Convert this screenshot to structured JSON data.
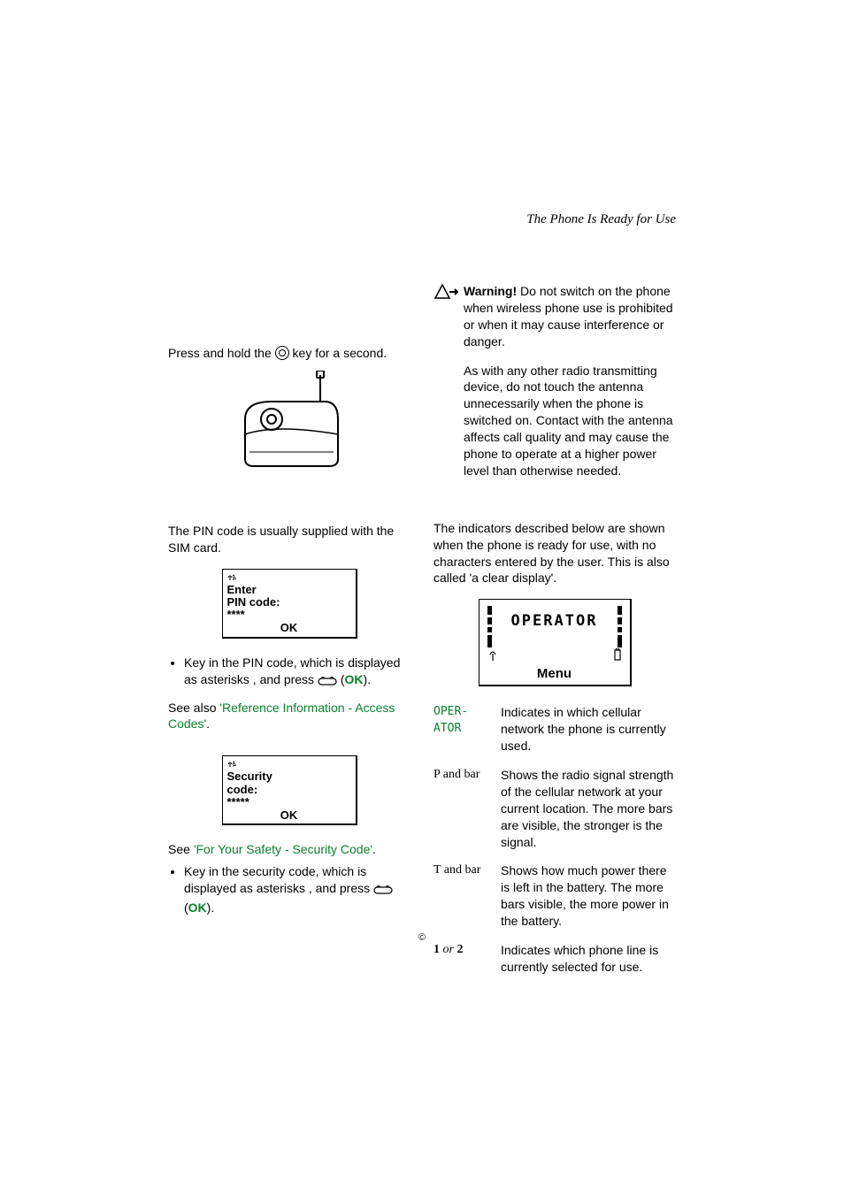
{
  "runningHeader": "The Phone Is Ready for Use",
  "left": {
    "pressHold_a": "Press and hold the ",
    "pressHold_b": " key for a second.",
    "pinSupplied": "The PIN code is usually supplied with the SIM card.",
    "displayPin_line1": "Enter",
    "displayPin_line2": "PIN code:",
    "displayPin_mask": "****",
    "displayPin_ok": "OK",
    "bulletPin_a": "Key in the PIN code, which is displayed as as­terisks   , and press ",
    "bulletPin_ok": "OK",
    "bulletPin_b": ".",
    "seeAlso": "See also ",
    "refLink": "'Reference Information - Access Codes'",
    "seeAlsoEnd": ".",
    "displaySec_line1": "Security",
    "displaySec_line2": "code:",
    "displaySec_mask": "*****",
    "displaySec_ok": "OK",
    "see2": "See ",
    "safetyLink": "'For Your Safety - Security Code'",
    "see2End": ".",
    "bulletSec_a": "Key in the security code, which is displayed as asterisks   , and press ",
    "bulletSec_ok": "OK",
    "bulletSec_b": "."
  },
  "right": {
    "warnBold": "Warning! ",
    "warnText": "Do not switch on the phone when wireless phone use is prohibited or when it may cause interference or dan­ger.",
    "antennaText": "As with any other radio transmitting de­vice, do not touch the antenna unneces­sarily when the phone is switched on. Contact with the antenna affects call quality and may cause the phone to op­erate at a higher power level than other­wise needed.",
    "indicatorsIntro": "The indicators described below are shown when the phone is ready for use, with no characters entered by the user. This is also called 'a clear display'.",
    "opLabel": "OPERATOR",
    "menuLabel": "Menu",
    "ind": [
      {
        "term": "OPER-\nATOR",
        "termClass": "mono",
        "desc": "Indicates in which cellular network the phone is currently used."
      },
      {
        "term": "P and bar",
        "termClass": "",
        "desc": "Shows the radio signal strength of the cellular network at your current location. The more bars are visible, the stronger is the signal."
      },
      {
        "term": "T and bar",
        "termClass": "",
        "desc": "Shows how much power there is left in the battery. The more bars visible, the more power in the bat­tery."
      },
      {
        "term": "1 or 2",
        "termClass": "",
        "desc": "Indicates which phone line is cur­rently selected for use."
      }
    ]
  },
  "footer": "©"
}
